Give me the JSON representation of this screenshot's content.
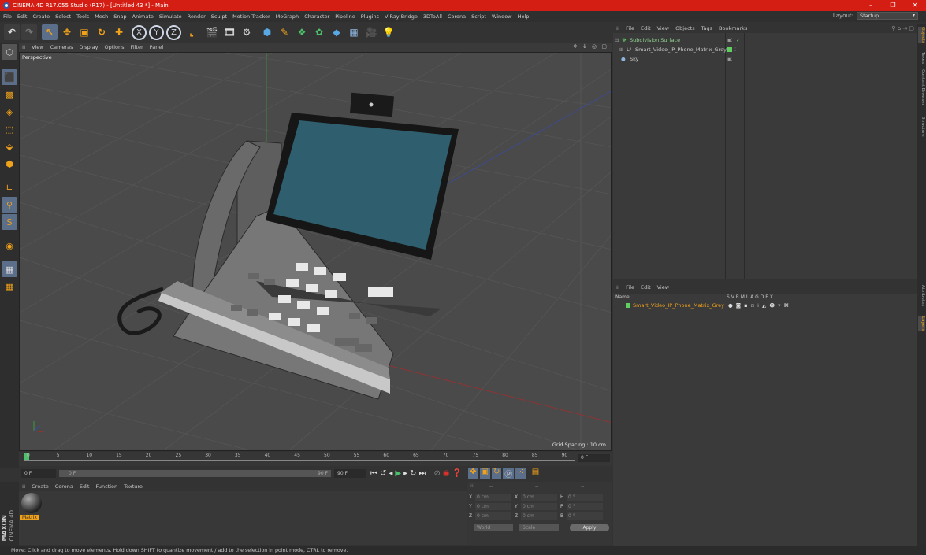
{
  "window": {
    "title": "CINEMA 4D R17.055 Studio (R17) - [Untitled 43 *] - Main",
    "min": "–",
    "max": "❐",
    "close": "✕"
  },
  "menu": [
    "File",
    "Edit",
    "Create",
    "Select",
    "Tools",
    "Mesh",
    "Snap",
    "Animate",
    "Simulate",
    "Render",
    "Sculpt",
    "Motion Tracker",
    "MoGraph",
    "Character",
    "Pipeline",
    "Plugins",
    "V-Ray Bridge",
    "3DToAll",
    "Corona",
    "Script",
    "Window",
    "Help"
  ],
  "layout": {
    "label": "Layout:",
    "value": "Startup"
  },
  "toolbar": {
    "x_label": "X",
    "y_label": "Y",
    "z_label": "Z"
  },
  "viewport": {
    "menu": [
      "View",
      "Cameras",
      "Display",
      "Options",
      "Filter",
      "Panel"
    ],
    "name": "Perspective",
    "grid_spacing": "Grid Spacing : 10 cm",
    "icons": "✥ ↓ ◎ ▢"
  },
  "timeline": {
    "ticks": [
      "0",
      "5",
      "10",
      "15",
      "20",
      "25",
      "30",
      "35",
      "40",
      "45",
      "50",
      "55",
      "60",
      "65",
      "70",
      "75",
      "80",
      "85",
      "90"
    ],
    "end_frame": "0 F"
  },
  "playbar": {
    "start": "0 F",
    "current": "0 F",
    "range_end": "90 F",
    "end": "90 F"
  },
  "material_menu": [
    "Create",
    "Corona",
    "Edit",
    "Function",
    "Texture"
  ],
  "material": {
    "name": "Matrix"
  },
  "coords": {
    "col_headers": [
      "--",
      "--",
      "--"
    ],
    "rows": [
      {
        "a": "X",
        "av": "0 cm",
        "b": "X",
        "bv": "0 cm",
        "c": "H",
        "cv": "0 °"
      },
      {
        "a": "Y",
        "av": "0 cm",
        "b": "Y",
        "bv": "0 cm",
        "c": "P",
        "cv": "0 °"
      },
      {
        "a": "Z",
        "av": "0 cm",
        "b": "Z",
        "bv": "0 cm",
        "c": "B",
        "cv": "0 °"
      }
    ],
    "world": "World",
    "scale": "Scale",
    "apply": "Apply"
  },
  "status": "Move: Click and drag to move elements. Hold down SHIFT to quantize movement / add to the selection in point mode, CTRL to remove.",
  "maxon": {
    "brand": "MAXON",
    "product": "CINEMA 4D"
  },
  "object_manager": {
    "menu": [
      "File",
      "Edit",
      "View",
      "Objects",
      "Tags",
      "Bookmarks"
    ],
    "objects": [
      {
        "name": "Subdivision Surface",
        "color": "#5fcf5f"
      },
      {
        "name": "Smart_Video_IP_Phone_Matrix_Grey",
        "color": "#bbbbbb"
      },
      {
        "name": "Sky",
        "color": "#bbbbbb"
      }
    ]
  },
  "attr_manager": {
    "menu": [
      "File",
      "Edit",
      "View"
    ],
    "header_name": "Name",
    "header_flags": "S  V  R  M  L  A  G  D  E  X",
    "layer_name": "Smart_Video_IP_Phone_Matrix_Grey",
    "layer_color": "#5fcf5f"
  },
  "right_tabs": [
    "Objects",
    "Takes",
    "Content Browser",
    "Structure",
    "Attributes",
    "Layers"
  ],
  "colors": {
    "titlebar": "#d41e14",
    "accent": "#f0a21b",
    "green": "#5fcf5f"
  }
}
